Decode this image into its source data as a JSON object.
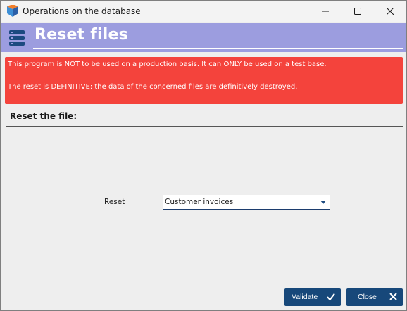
{
  "window": {
    "title": "Operations on the database",
    "controls": [
      "minimize-icon",
      "maximize-icon",
      "close-icon"
    ]
  },
  "header": {
    "title": "Reset files",
    "icon": "database-icon",
    "band_color": "#9c9ddf"
  },
  "warning": {
    "line1": "This program is NOT to be used on a production basis. It can ONLY be used on a test base.",
    "line2": "The reset is DEFINITIVE: the data of the concerned files are definitively destroyed.",
    "color": "#f4433c"
  },
  "section": {
    "title": "Reset the file:"
  },
  "form": {
    "reset_label": "Reset",
    "reset_value": "Customer invoices"
  },
  "buttons": {
    "validate_label": "Validate",
    "close_label": "Close",
    "color": "#17487a"
  }
}
